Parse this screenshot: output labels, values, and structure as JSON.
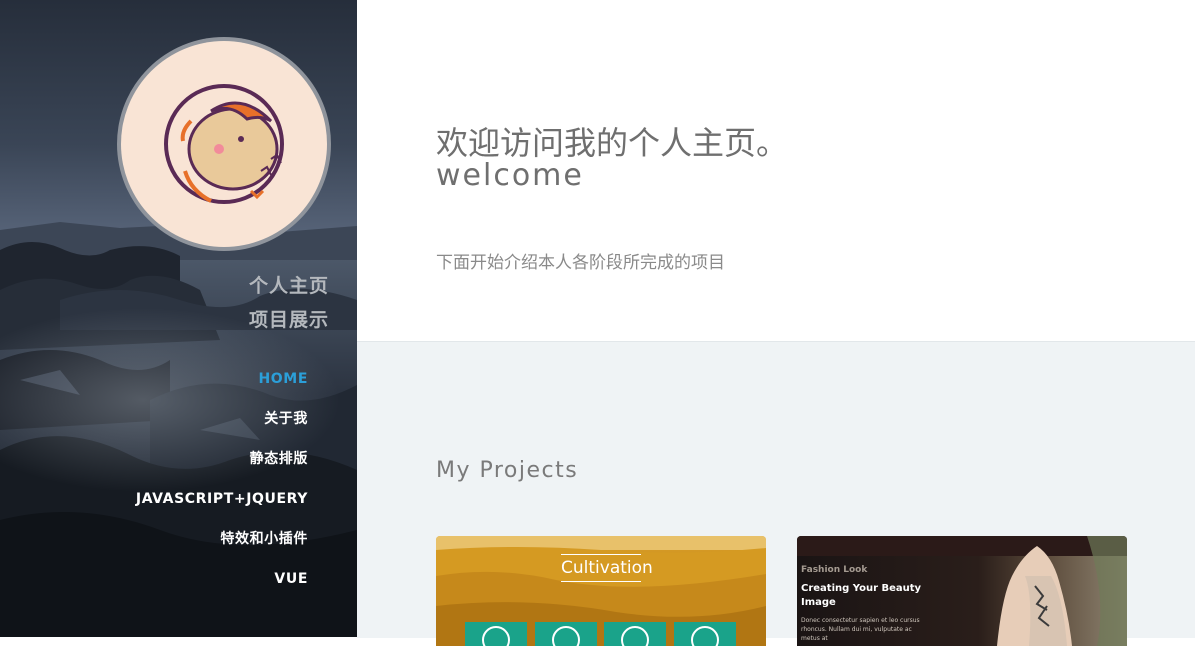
{
  "sidebar": {
    "brand_line1": "个人主页",
    "brand_line2": "项目展示",
    "nav": [
      "HOME",
      "关于我",
      "静态排版",
      "JAVASCRIPT+JQUERY",
      "特效和小插件",
      "VUE"
    ]
  },
  "hero": {
    "title": "欢迎访问我的个人主页。",
    "subtitle": "welcome",
    "description": "下面开始介绍本人各阶段所完成的项目"
  },
  "projects": {
    "heading": "My Projects",
    "cards": [
      {
        "title": "Cultivation"
      },
      {
        "eyebrow": "Fashion Look",
        "headline": "Creating Your Beauty Image",
        "body": "Donec consectetur sapien et leo cursus rhoncus. Nullam dui mi, vulputate ac metus at"
      }
    ]
  },
  "colors": {
    "accent": "#2b9fd9",
    "sidebar_bg": "#2a3342",
    "teal_tile": "#1aa38a"
  }
}
